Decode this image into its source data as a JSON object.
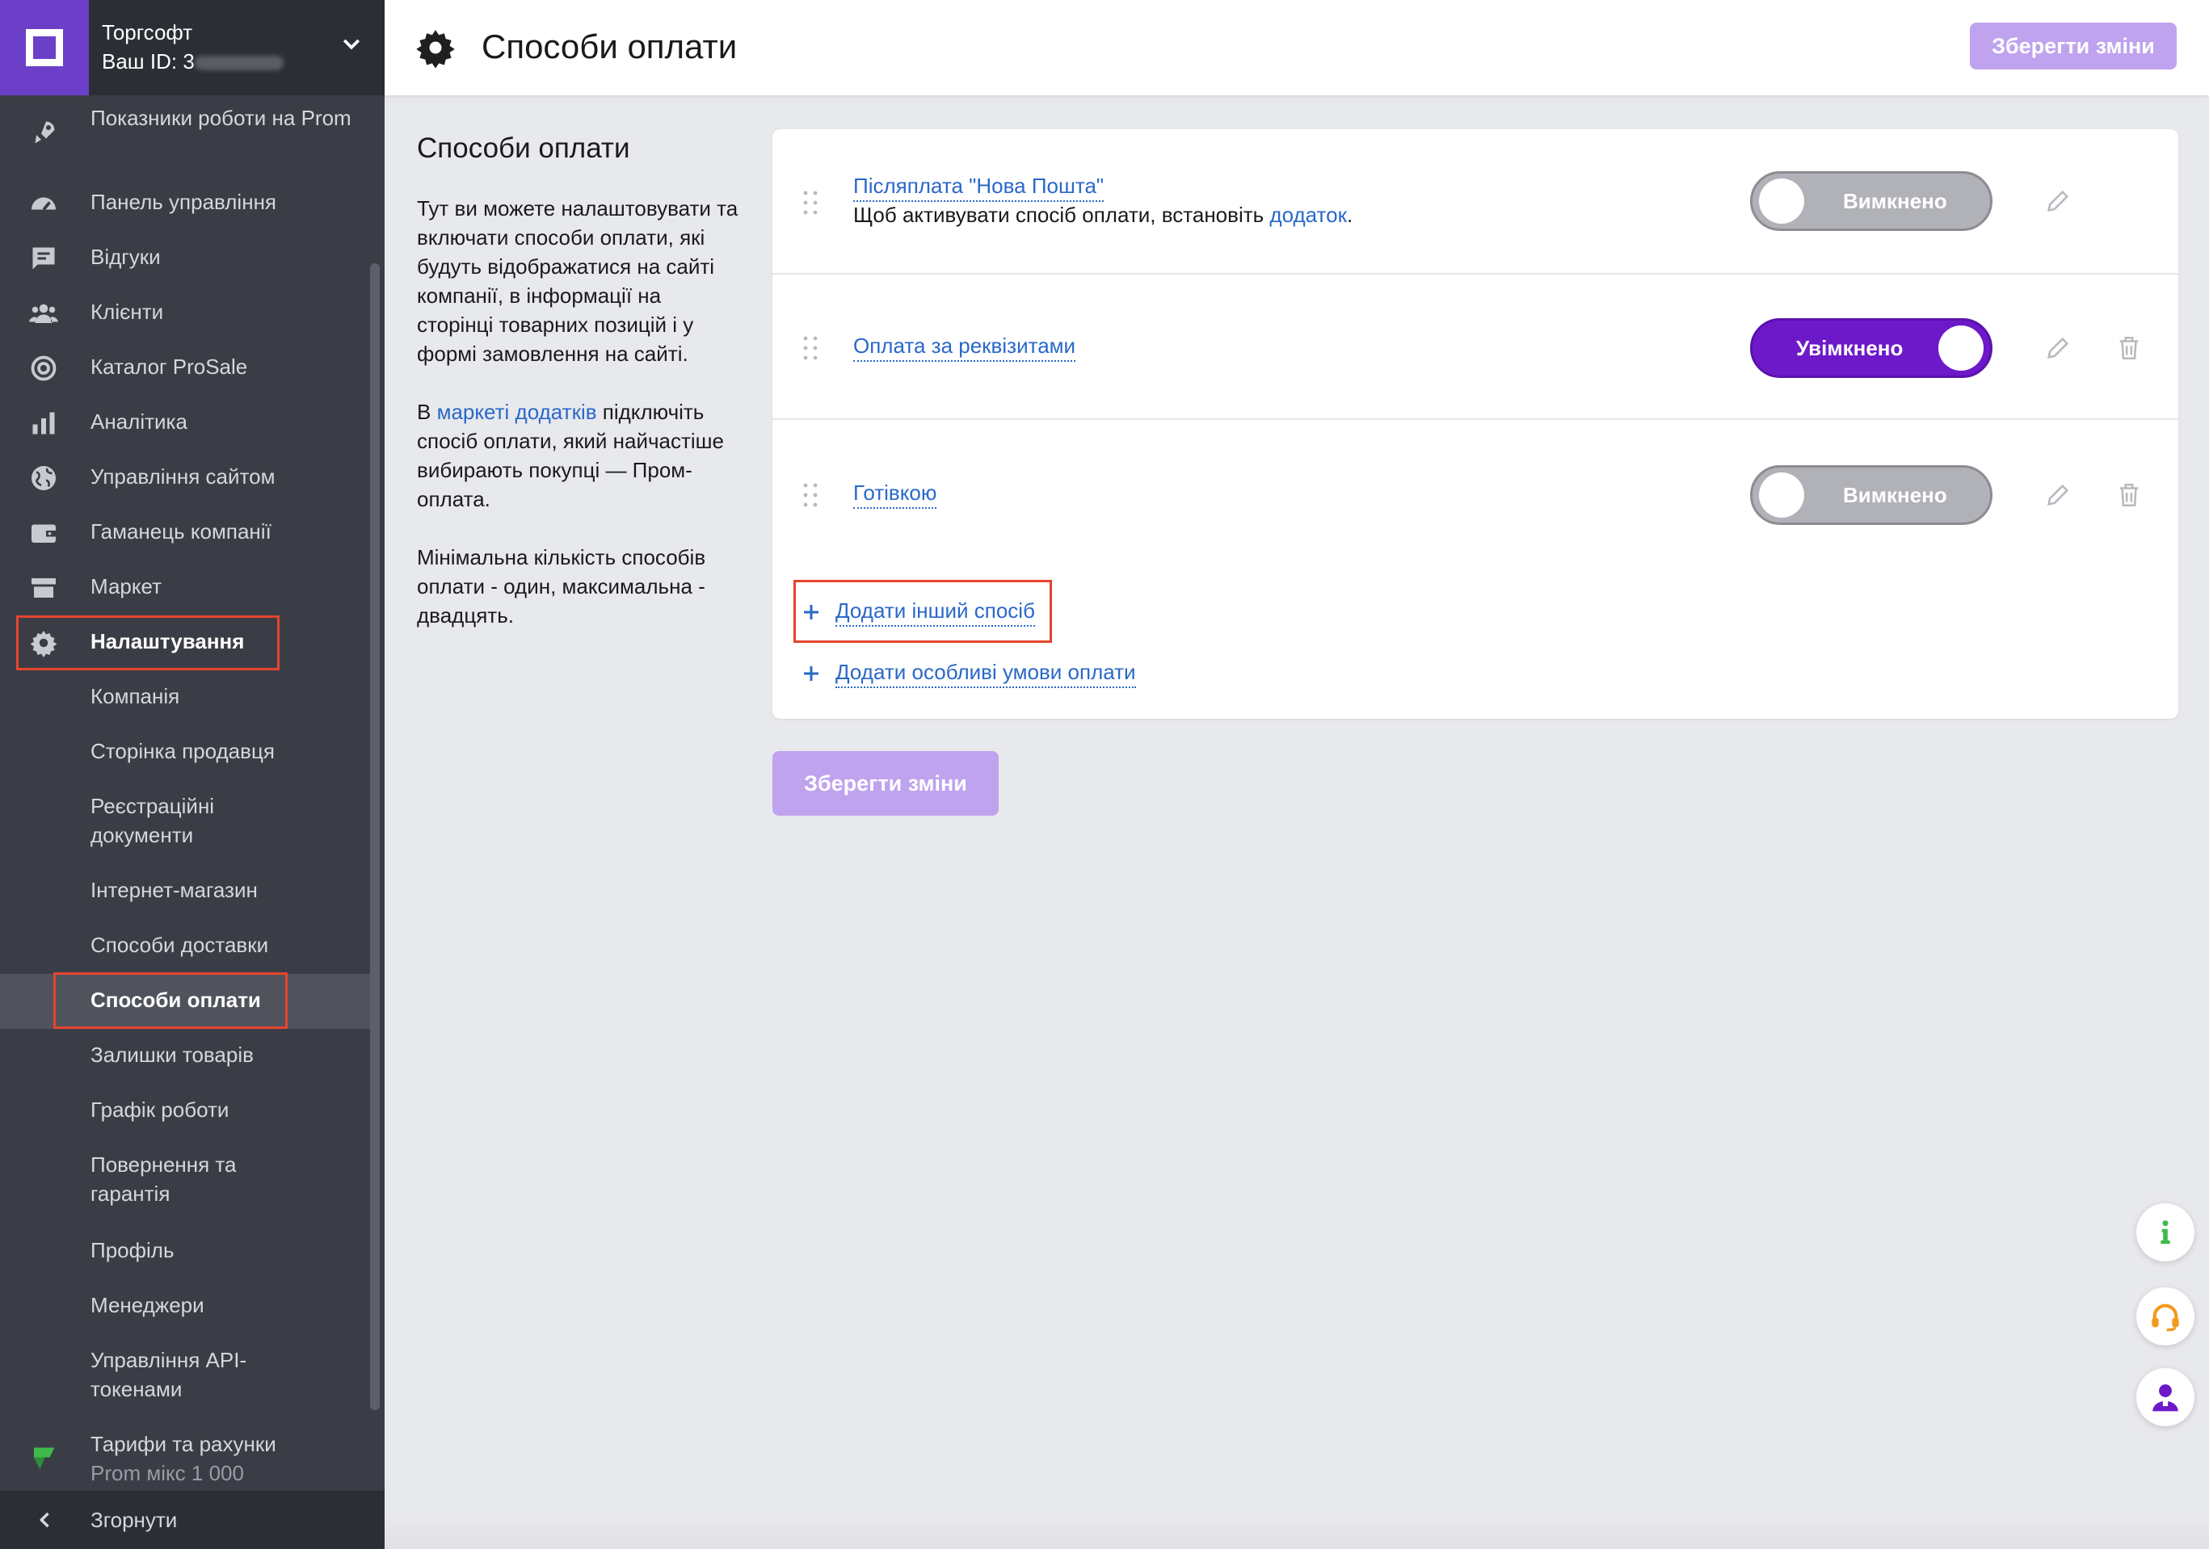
{
  "sidebar": {
    "company_name": "Торгсофт",
    "id_label": "Ваш ID: 3",
    "items": [
      {
        "label": "Показники роботи на Prom",
        "icon": "rocket-icon"
      },
      {
        "label": "Панель управління",
        "icon": "dashboard-icon"
      },
      {
        "label": "Відгуки",
        "icon": "message-icon"
      },
      {
        "label": "Клієнти",
        "icon": "people-icon"
      },
      {
        "label": "Каталог ProSale",
        "icon": "target-icon"
      },
      {
        "label": "Аналітика",
        "icon": "bar-chart-icon"
      },
      {
        "label": "Управління сайтом",
        "icon": "globe-icon"
      },
      {
        "label": "Гаманець компанії",
        "icon": "wallet-icon"
      },
      {
        "label": "Маркет",
        "icon": "store-icon"
      },
      {
        "label": "Налаштування",
        "icon": "gear-icon"
      }
    ],
    "subitems": [
      "Компанія",
      "Сторінка продавця",
      "Реєстраційні документи",
      "Інтернет-магазин",
      "Способи доставки",
      "Способи оплати",
      "Залишки товарів",
      "Графік роботи",
      "Повернення та гарантія",
      "Профіль",
      "Менеджери",
      "Управління API-токенами"
    ],
    "tariff": {
      "label": "Тарифи та рахунки",
      "plan": "Prom мікс 1 000",
      "icon": "tariff-icon"
    },
    "collapse_label": "Згорнути"
  },
  "header": {
    "title": "Способи оплати",
    "save_label": "Зберегти зміни"
  },
  "description": {
    "title": "Способи оплати",
    "para1": "Тут ви можете налаштовувати та включати способи оплати, які будуть відображатися на сайті компанії, в інформації на сторінці товарних позицій і у формі замовлення на сайті.",
    "para2_prefix": "В ",
    "para2_link": "маркеті додатків",
    "para2_suffix": " підключіть спосіб оплати, який найчастіше вибирають покупці — Пром-оплата.",
    "para3": "Мінімальна кількість способів оплати - один, максимальна - двадцять."
  },
  "payment_methods": [
    {
      "name": "Післяплата \"Нова Пошта\"",
      "note_prefix": "Щоб активувати спосіб оплати, встановіть ",
      "note_link": "додаток",
      "note_suffix": ".",
      "status": "Вимкнено",
      "enabled": false
    },
    {
      "name": "Оплата за реквізитами",
      "status": "Увімкнено",
      "enabled": true
    },
    {
      "name": "Готівкою",
      "status": "Вимкнено",
      "enabled": false
    }
  ],
  "actions": {
    "add_method": "Додати інший спосіб",
    "add_conditions": "Додати особливі умови оплати",
    "save_label": "Зберегти зміни"
  },
  "colors": {
    "accent": "#6d19c9",
    "link": "#2a68c9",
    "sidebar_bg": "#3b3d46",
    "highlight": "#e5452e"
  }
}
